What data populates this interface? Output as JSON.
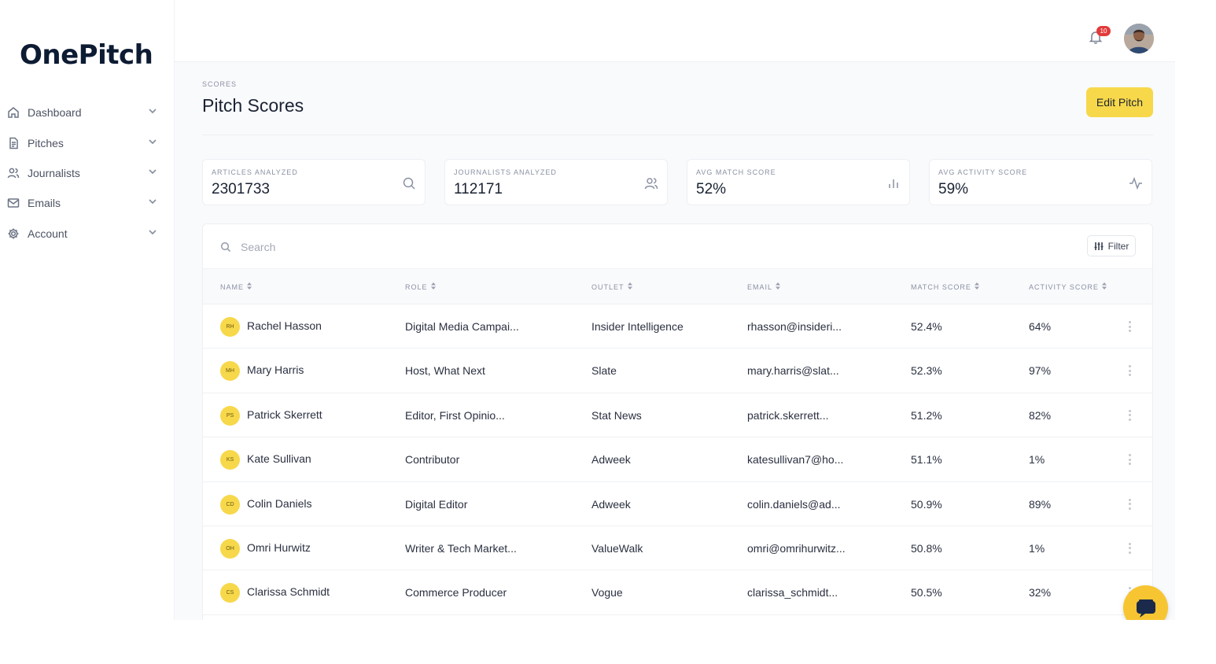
{
  "app": {
    "logo": "OnePitch"
  },
  "sidebar": {
    "items": [
      {
        "label": "Dashboard",
        "icon": "home-icon"
      },
      {
        "label": "Pitches",
        "icon": "document-icon"
      },
      {
        "label": "Journalists",
        "icon": "users-icon"
      },
      {
        "label": "Emails",
        "icon": "mail-icon"
      },
      {
        "label": "Account",
        "icon": "gear-icon"
      }
    ]
  },
  "topbar": {
    "notification_count": "10"
  },
  "header": {
    "breadcrumb": "SCORES",
    "title": "Pitch Scores",
    "edit_label": "Edit Pitch"
  },
  "stats": [
    {
      "label": "ARTICLES ANALYZED",
      "value": "2301733",
      "icon": "search-icon"
    },
    {
      "label": "JOURNALISTS ANALYZED",
      "value": "112171",
      "icon": "users-icon"
    },
    {
      "label": "AVG MATCH SCORE",
      "value": "52%",
      "icon": "bar-chart-icon"
    },
    {
      "label": "AVG ACTIVITY SCORE",
      "value": "59%",
      "icon": "activity-icon"
    }
  ],
  "table": {
    "search_placeholder": "Search",
    "filter_label": "Filter",
    "columns": [
      "NAME",
      "ROLE",
      "OUTLET",
      "EMAIL",
      "MATCH SCORE",
      "ACTIVITY SCORE"
    ],
    "rows": [
      {
        "initials": "RH",
        "name": "Rachel Hasson",
        "role": "Digital Media Campai...",
        "outlet": "Insider Intelligence",
        "email": "rhasson@insideri...",
        "match": "52.4%",
        "activity": "64%"
      },
      {
        "initials": "MH",
        "name": "Mary Harris",
        "role": "Host, What Next",
        "outlet": "Slate",
        "email": "mary.harris@slat...",
        "match": "52.3%",
        "activity": "97%"
      },
      {
        "initials": "PS",
        "name": "Patrick Skerrett",
        "role": "Editor, First Opinio...",
        "outlet": "Stat News",
        "email": "patrick.skerrett...",
        "match": "51.2%",
        "activity": "82%"
      },
      {
        "initials": "KS",
        "name": "Kate Sullivan",
        "role": "Contributor",
        "outlet": "Adweek",
        "email": "katesullivan7@ho...",
        "match": "51.1%",
        "activity": "1%"
      },
      {
        "initials": "CD",
        "name": "Colin Daniels",
        "role": "Digital Editor",
        "outlet": "Adweek",
        "email": "colin.daniels@ad...",
        "match": "50.9%",
        "activity": "89%"
      },
      {
        "initials": "OH",
        "name": "Omri Hurwitz",
        "role": "Writer & Tech Market...",
        "outlet": "ValueWalk",
        "email": "omri@omrihurwitz...",
        "match": "50.8%",
        "activity": "1%"
      },
      {
        "initials": "CS",
        "name": "Clarissa Schmidt",
        "role": "Commerce Producer",
        "outlet": "Vogue",
        "email": "clarissa_schmidt...",
        "match": "50.5%",
        "activity": "32%"
      }
    ]
  },
  "colors": {
    "accent": "#f7d84a",
    "badge": "#e23a3a",
    "chat": "#f7c531"
  }
}
